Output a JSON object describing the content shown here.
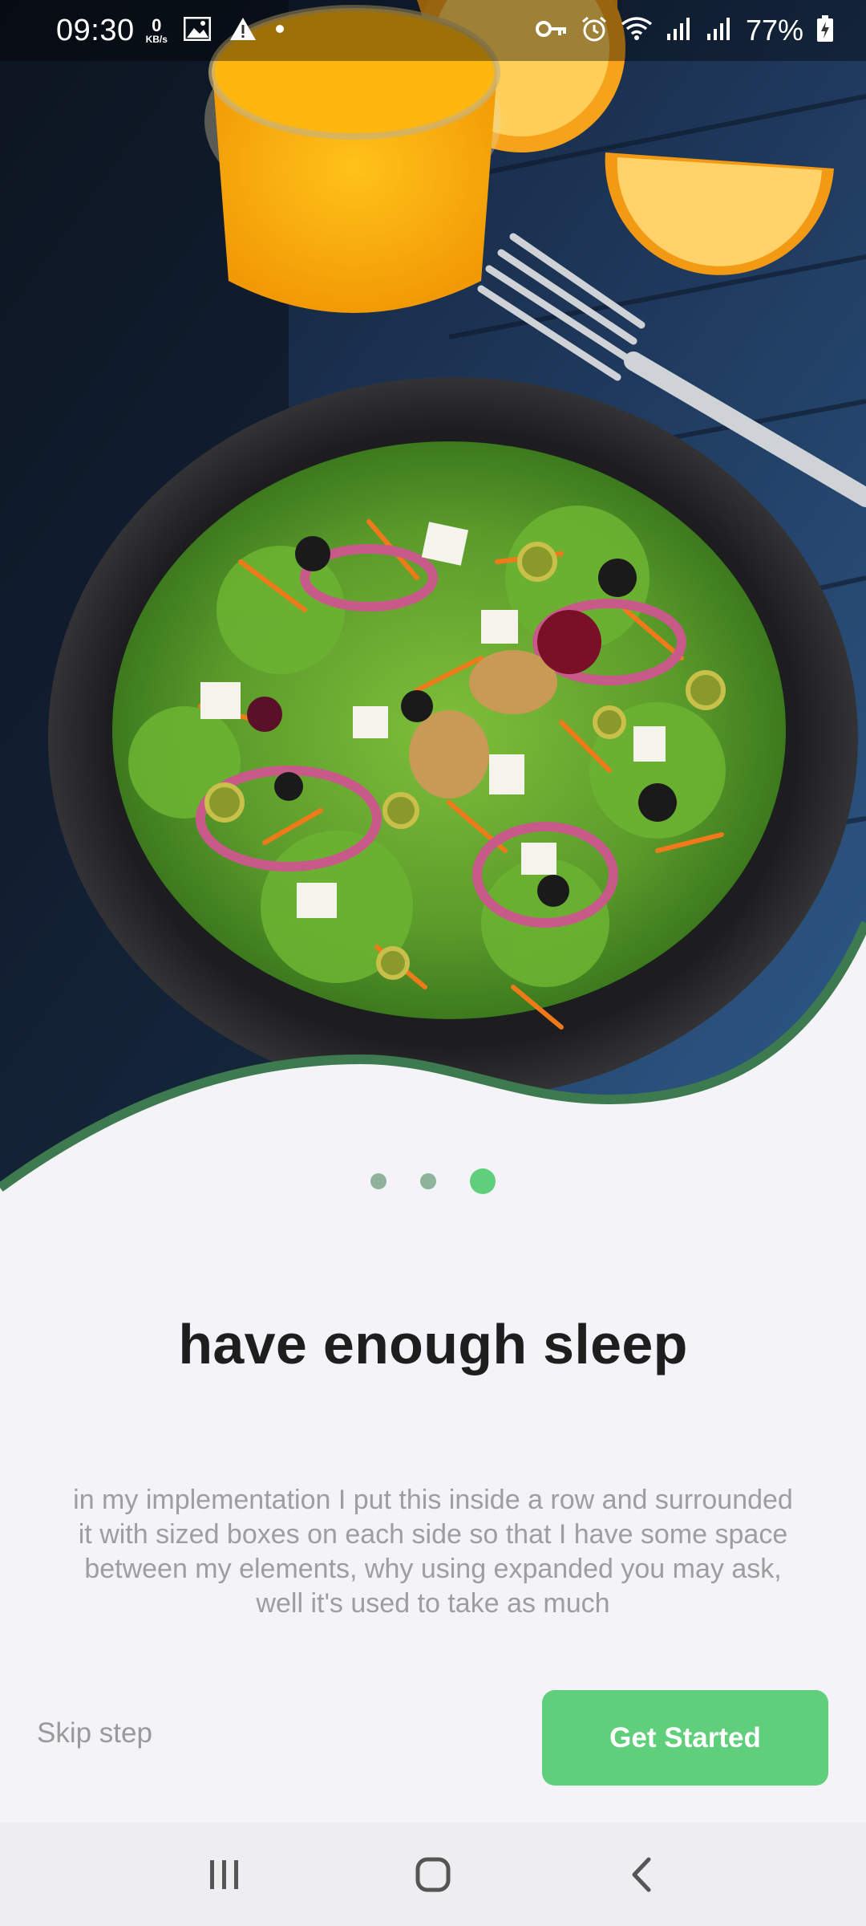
{
  "status_bar": {
    "time": "09:30",
    "net_speed_value": "0",
    "net_speed_unit": "KB/s",
    "battery_percent": "77%",
    "icons_left": [
      "gallery-icon",
      "warning-icon",
      "dot-icon"
    ],
    "icons_right": [
      "vpn-key-icon",
      "alarm-icon",
      "wifi-icon",
      "signal-icon",
      "signal-icon",
      "battery-charging-icon"
    ]
  },
  "hero": {
    "image": "salad-bowl-with-orange-juice-photo",
    "accent_color": "#3d7a4f"
  },
  "pager": {
    "count": 3,
    "active_index": 2,
    "active_color": "#5fcf7b",
    "inactive_color": "#8fb29a"
  },
  "onboarding": {
    "title": "have enough sleep",
    "description": "in my implementation I put this inside a row and surrounded it with sized boxes on each side so that I have some space between my elements, why using expanded you may ask, well it's used to take as much"
  },
  "actions": {
    "skip_label": "Skip step",
    "primary_label": "Get Started",
    "primary_color": "#5fcf7b"
  },
  "nav_bar": {
    "buttons": [
      "recent-apps-icon",
      "home-icon",
      "back-icon"
    ]
  }
}
